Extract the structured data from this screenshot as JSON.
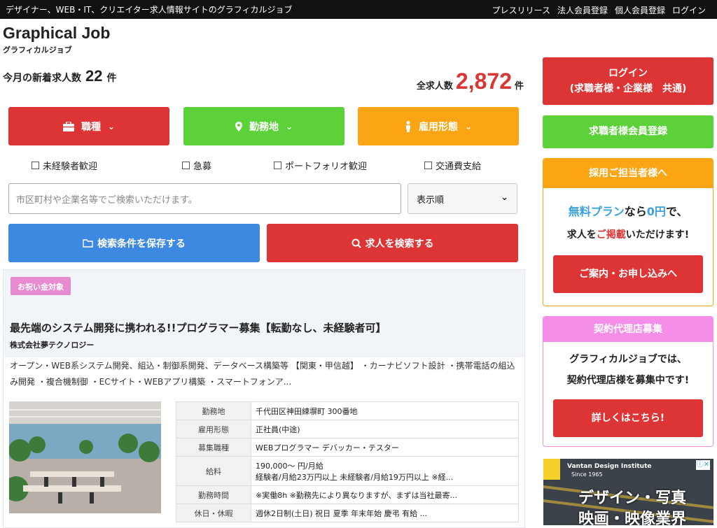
{
  "topbar": {
    "tagline": "デザイナー、WEB・IT、クリエイター求人情報サイトのグラフィカルジョブ",
    "links": [
      "プレスリリース",
      "法人会員登録",
      "個人会員登録",
      "ログイン"
    ]
  },
  "header": {
    "logo": "Graphical Job",
    "logo_sub": "グラフィカルジョブ",
    "new_label": "今月の新着求人数",
    "new_count": "22",
    "new_unit": "件",
    "total_label": "全求人数",
    "total_count": "2,872",
    "total_unit": "件"
  },
  "filters": {
    "job_type": "職種",
    "location": "勤務地",
    "employment": "雇用形態",
    "colors": {
      "job_type": "#dd3535",
      "location": "#5dd13a",
      "employment": "#fca514"
    }
  },
  "checkboxes": [
    "未経験者歓迎",
    "急募",
    "ポートフォリオ歓迎",
    "交通費支給"
  ],
  "search": {
    "placeholder": "市区町村や企業名等でご検索いただけます。",
    "sort_selected": "表示順",
    "save_label": "検索条件を保存する",
    "search_label": "求人を検索する"
  },
  "job": {
    "badge": "お祝い金対象",
    "title": "最先端のシステム開発に携われる!!プログラマー募集【転勤なし、未経験者可】",
    "company": "株式会社夢テクノロジー",
    "description": "オープン・WEB系システム開発、組込・制御系開発、データベース構築等 【関東・甲信越】 ・カーナビソフト設計 ・携帯電話の組込み開発 ・複合機制御 ・ECサイト・WEBアプリ構築 ・スマートフォンア...",
    "details": [
      {
        "key": "勤務地",
        "value": "千代田区神田練塀町 300番地"
      },
      {
        "key": "雇用形態",
        "value": "正社員(中途)"
      },
      {
        "key": "募集職種",
        "value": "WEBプログラマー デバッカー・テスター"
      },
      {
        "key": "給料",
        "value": "190,000～ 円/月給\n経験者/月給23万円以上 未経験者/月給19万円以上 ※経..."
      },
      {
        "key": "勤務時間",
        "value": "※実働8h ※勤務先により異なりますが、まずは当社最寄..."
      },
      {
        "key": "休日・休暇",
        "value": "週休2日制(土日) 祝日 夏季 年末年始 慶弔 有給 ..."
      }
    ]
  },
  "sidebar": {
    "login_line1": "ログイン",
    "login_line2": "(求職者様・企業様　共通)",
    "register": "求職者様会員登録",
    "employer_header": "採用ご担当者様へ",
    "employer_free": "無料プラン",
    "employer_nara": "なら",
    "employer_zero": "0円",
    "employer_de": "で、",
    "employer_line2_a": "求人を",
    "employer_line2_b": "ご掲載",
    "employer_line2_c": "いただけます!",
    "employer_button": "ご案内・お申し込みへ",
    "agency_header": "契約代理店募集",
    "agency_line1": "グラフィカルジョブでは、",
    "agency_line2": "契約代理店様を募集中です!",
    "agency_button": "詳しくはこちら!"
  },
  "ad": {
    "brand": "Vantan Design Institute",
    "since": "Since 1965",
    "line1": "デザイン・写真",
    "line2": "映画・映像業界"
  }
}
